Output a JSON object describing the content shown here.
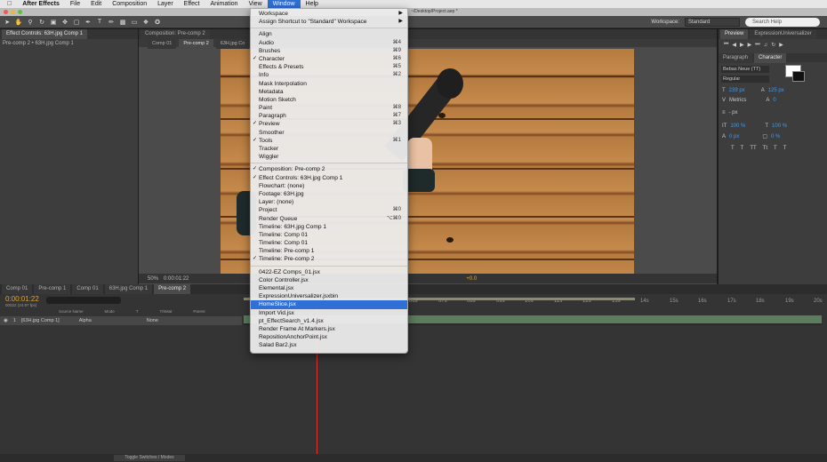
{
  "menubar": {
    "app": "After Effects",
    "items": [
      "File",
      "Edit",
      "Composition",
      "Layer",
      "Effect",
      "Animation",
      "View",
      "Window",
      "Help"
    ],
    "active": "Window"
  },
  "titlebar": {
    "text": "~/Desktop/Project.aep *"
  },
  "workspace": {
    "label": "Workspace:",
    "value": "Standard",
    "search_placeholder": "Search Help"
  },
  "left_panel": {
    "tab": "Effect Controls: 63H.jpg Comp 1",
    "subtitle": "Pre-comp 2 • 63H.jpg Comp 1"
  },
  "viewer": {
    "tabs": [
      "Composition: Pre-comp 2",
      "Comp 01",
      "Pre-comp 2",
      "63H.jpg Co"
    ],
    "zoom": "50%",
    "timecode": "0:00:01:22",
    "offset": "+0.0"
  },
  "right_panel": {
    "tabs_top": [
      "Preview",
      "ExpressionUniversalizer"
    ],
    "tabs_char": [
      "Paragraph",
      "Character"
    ],
    "font_family": "Bebas Neue (TT)",
    "font_style": "Regular",
    "font_size": "239 px",
    "leading": "125 px",
    "kerning": "Metrics",
    "tracking": "0",
    "stroke": "- px",
    "vscale": "100 %",
    "hscale": "100 %",
    "baseline": "0 px",
    "tsume": "0 %",
    "style_buttons": [
      "T",
      "T",
      "TT",
      "Tt",
      "T",
      "T"
    ]
  },
  "timeline": {
    "tabs": [
      "Comp 01",
      "Pre-comp 1",
      "Comp 01",
      "63H.jpg Comp 1",
      "Pre-comp 2"
    ],
    "timecode": "0:00:01:22",
    "fps": "00022 (24.97 fps)",
    "columns": [
      "Source Name",
      "Mode",
      "T",
      "TrkMat",
      "Parent"
    ],
    "layer": {
      "num": "1",
      "name": "[63H.jpg Comp 1]",
      "mode": "Alpha",
      "parent": "None"
    },
    "ruler": [
      "06s",
      "07s",
      "08s",
      "09s",
      "10s",
      "11s",
      "12s",
      "13s",
      "14s",
      "15s",
      "16s",
      "17s",
      "18s",
      "19s",
      "20s"
    ],
    "toggle_label": "Toggle Switches / Modes"
  },
  "window_menu": {
    "items": [
      {
        "label": "Workspace",
        "submenu": true
      },
      {
        "label": "Assign Shortcut to \"Standard\" Workspace",
        "submenu": true
      },
      {
        "sep": true
      },
      {
        "label": "Align"
      },
      {
        "label": "Audio",
        "shortcut": "⌘4"
      },
      {
        "label": "Brushes",
        "shortcut": "⌘9"
      },
      {
        "label": "Character",
        "check": true,
        "shortcut": "⌘6"
      },
      {
        "label": "Effects & Presets",
        "shortcut": "⌘5"
      },
      {
        "label": "Info",
        "shortcut": "⌘2"
      },
      {
        "label": "Mask Interpolation"
      },
      {
        "label": "Metadata"
      },
      {
        "label": "Motion Sketch"
      },
      {
        "label": "Paint",
        "shortcut": "⌘8"
      },
      {
        "label": "Paragraph",
        "shortcut": "⌘7"
      },
      {
        "label": "Preview",
        "check": true,
        "shortcut": "⌘3"
      },
      {
        "label": "Smoother"
      },
      {
        "label": "Tools",
        "check": true,
        "shortcut": "⌘1"
      },
      {
        "label": "Tracker"
      },
      {
        "label": "Wiggler"
      },
      {
        "sep": true
      },
      {
        "label": "Composition: Pre-comp 2",
        "check": true
      },
      {
        "label": "Effect Controls: 63H.jpg Comp 1",
        "check": true
      },
      {
        "label": "Flowchart: (none)"
      },
      {
        "label": "Footage: 63H.jpg"
      },
      {
        "label": "Layer: (none)"
      },
      {
        "label": "Project",
        "shortcut": "⌘0"
      },
      {
        "label": "Render Queue",
        "shortcut": "⌥⌘0"
      },
      {
        "label": "Timeline: 63H.jpg Comp 1"
      },
      {
        "label": "Timeline: Comp 01"
      },
      {
        "label": "Timeline: Comp 01"
      },
      {
        "label": "Timeline: Pre-comp 1"
      },
      {
        "label": "Timeline: Pre-comp 2",
        "check": true
      },
      {
        "sep": true
      },
      {
        "label": "0422-EZ Comps_01.jsx"
      },
      {
        "label": "Color Controller.jsx"
      },
      {
        "label": "Elemental.jsx"
      },
      {
        "label": "ExpressionUniversalizer.jsxbin"
      },
      {
        "label": "HomeSlice.jsx",
        "highlight": true
      },
      {
        "label": "Import Vid.jsx"
      },
      {
        "label": "pt_EffectSearch_v1.4.jsx"
      },
      {
        "label": "Render Frame At Markers.jsx"
      },
      {
        "label": "RepositionAnchorPoint.jsx"
      },
      {
        "label": "Salad Bar2.jsx"
      }
    ]
  },
  "colors": {
    "accent": "#2f6fd6",
    "timecode": "#e0a33a",
    "value_blue": "#3a9bf0"
  }
}
